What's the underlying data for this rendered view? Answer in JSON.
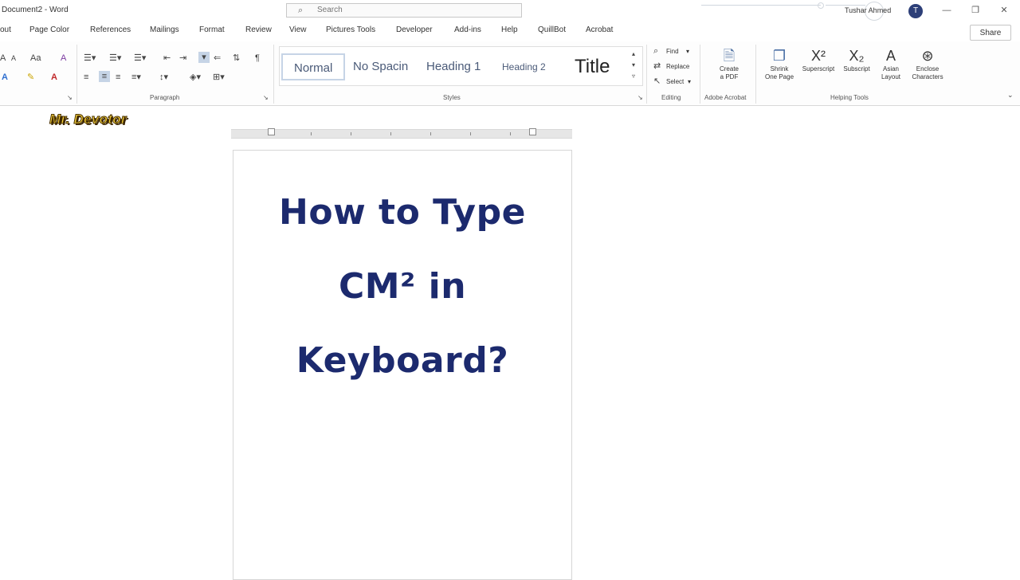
{
  "window": {
    "doc_title": "Document2 - Word",
    "search_placeholder": "Search",
    "user_name": "Tushar Ahmed",
    "avatar_initial": "T",
    "minimize_label": "—",
    "restore_label": "❐",
    "close_label": "✕"
  },
  "tabs": [
    {
      "label": "out"
    },
    {
      "label": "Page Color"
    },
    {
      "label": "References"
    },
    {
      "label": "Mailings"
    },
    {
      "label": "Format"
    },
    {
      "label": "Review"
    },
    {
      "label": "View"
    },
    {
      "label": "Pictures Tools"
    },
    {
      "label": "Developer"
    },
    {
      "label": "Add-ins"
    },
    {
      "label": "Help"
    },
    {
      "label": "QuillBot"
    },
    {
      "label": "Acrobat"
    }
  ],
  "share_label": "Share",
  "ribbon": {
    "font_group": {
      "font_size_up": "A",
      "font_size_down": "A",
      "change_case": "Aa",
      "clear_format": "A",
      "text_effects": "A",
      "highlight": "✎",
      "font_color": "A"
    },
    "paragraph_label": "Paragraph",
    "pilcrow": "¶",
    "sort": "⇅",
    "styles_label": "Styles",
    "styles": [
      {
        "label": "Normal"
      },
      {
        "label": "No Spacin"
      },
      {
        "label": "Heading 1"
      },
      {
        "label": "Heading 2"
      },
      {
        "label": "Title"
      }
    ],
    "editing": {
      "find": "Find",
      "replace": "Replace",
      "select": "Select",
      "label": "Editing"
    },
    "adobe": {
      "create_pdf_line1": "Create",
      "create_pdf_line2": "a PDF",
      "label": "Adobe Acrobat"
    },
    "helping": {
      "shrink_line1": "Shrink",
      "shrink_line2": "One Page",
      "superscript": "Superscript",
      "subscript": "Subscript",
      "asian_line1": "Asian",
      "asian_line2": "Layout",
      "enclose_line1": "Enclose",
      "enclose_line2": "Characters",
      "label": "Helping Tools"
    }
  },
  "watermark": "Mr. Devotor",
  "document": {
    "lines": [
      "How to Type",
      "CM² in",
      "Keyboard?"
    ],
    "text_color": "#1c2a6e"
  }
}
